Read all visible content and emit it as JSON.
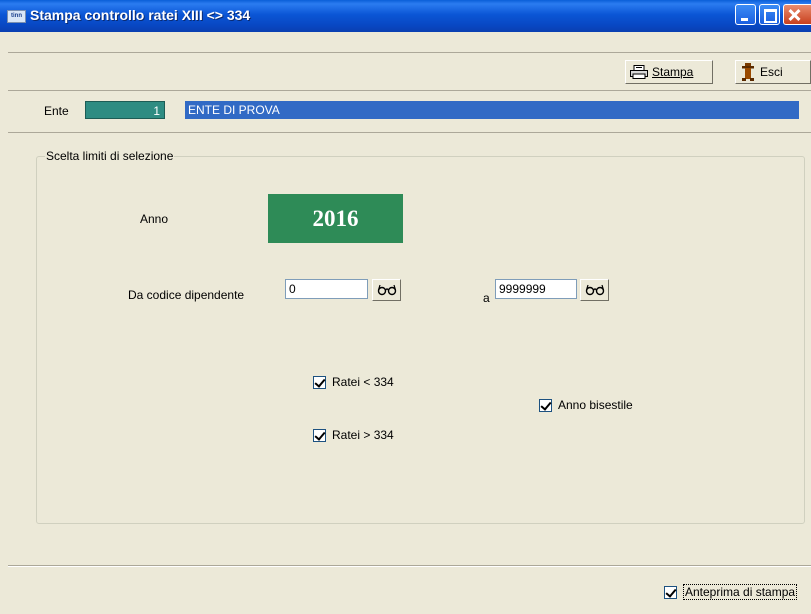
{
  "window": {
    "title": "Stampa controllo ratei XIII <> 334",
    "icon_text": "tinn"
  },
  "toolbar": {
    "stampa_label": "Stampa",
    "esci_label": "Esci"
  },
  "ente": {
    "label": "Ente",
    "code": "1",
    "name": "ENTE DI PROVA"
  },
  "group": {
    "legend": "Scelta limiti di selezione",
    "anno_label": "Anno",
    "anno_value": "2016",
    "da_codice_label": "Da codice dipendente",
    "da_codice_value": "0",
    "a_label": "a",
    "a_value": "9999999",
    "ratei_lt_label": "Ratei < 334",
    "ratei_lt_checked": true,
    "ratei_gt_label": "Ratei > 334",
    "ratei_gt_checked": true,
    "anno_bisestile_label": "Anno bisestile",
    "anno_bisestile_checked": true
  },
  "footer": {
    "anteprima_label": "Anteprima di stampa",
    "anteprima_checked": true
  },
  "colors": {
    "titlebar": "#0a54d0",
    "ente_code_bg": "#2e8c82",
    "ente_name_bg": "#316ac5",
    "anno_bg": "#2e8b57",
    "window_bg": "#ece9d8"
  },
  "icons": {
    "printer": "printer-icon",
    "exit": "exit-icon",
    "lookup": "binoculars-icon"
  }
}
